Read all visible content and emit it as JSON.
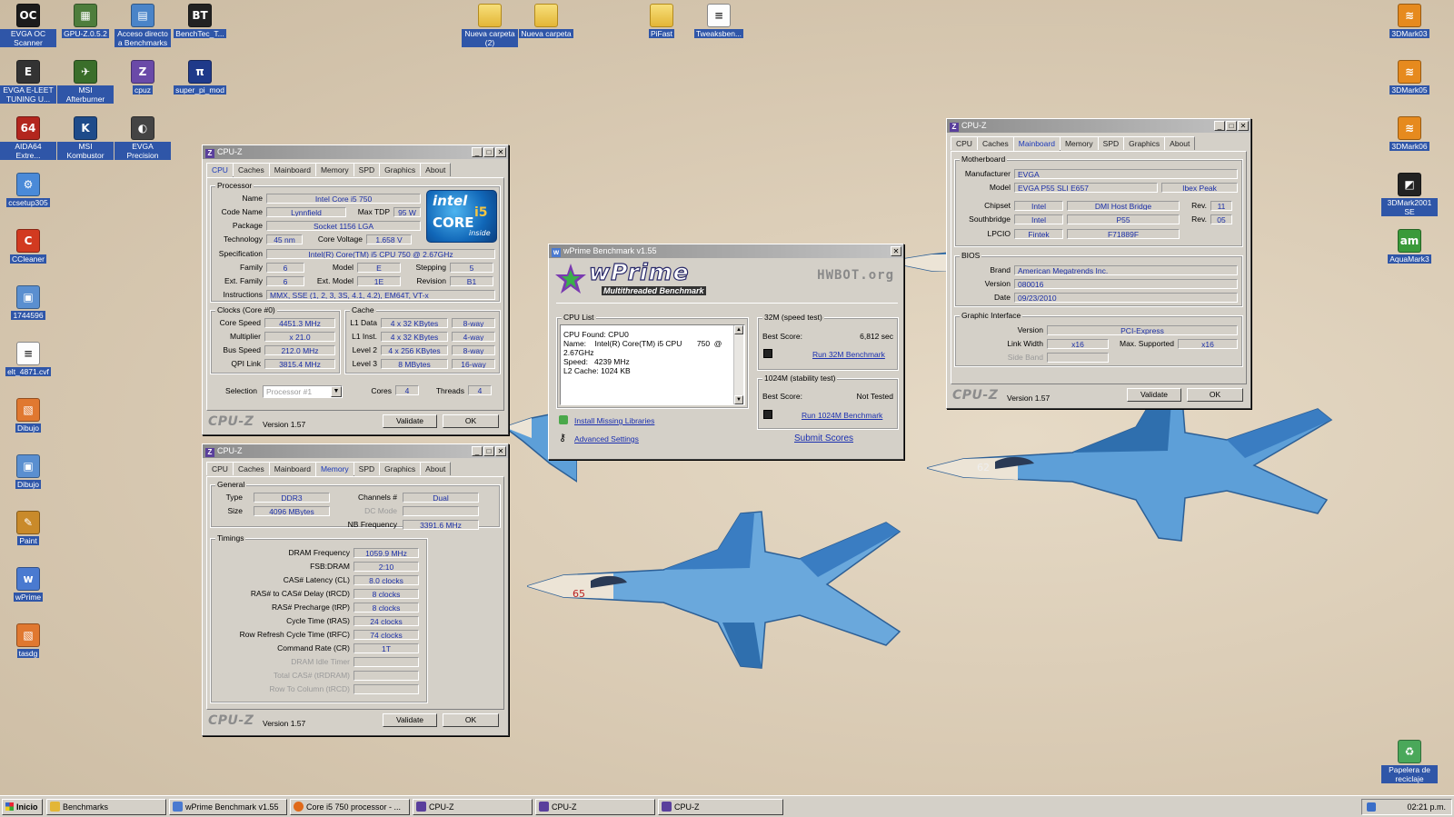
{
  "desktop_icons_left": [
    {
      "label": "EVGA OC Scanner",
      "icon": "evga-oc-icon",
      "color": "#1b1b1b",
      "glyph": "OC"
    },
    {
      "label": "GPU-Z.0.5.2",
      "icon": "gpuz-icon",
      "color": "#4e7d3c",
      "glyph": "▦"
    },
    {
      "label": "Acceso directo a Benchmarks",
      "icon": "folder-shortcut-icon",
      "color": "#4a84c8",
      "glyph": "▤"
    },
    {
      "label": "BenchTec_T...",
      "icon": "benchtec-icon",
      "color": "#222222",
      "glyph": "BT"
    },
    {
      "label": "EVGA E-LEET TUNING U...",
      "icon": "evga-eleet-icon",
      "color": "#333333",
      "glyph": "E"
    },
    {
      "label": "MSI Afterburner",
      "icon": "msi-afterburner-icon",
      "color": "#3a6e2a",
      "glyph": "✈"
    },
    {
      "label": "cpuz",
      "icon": "cpuz-icon",
      "color": "#6a4aa8",
      "glyph": "Z"
    },
    {
      "label": "super_pi_mod",
      "icon": "superpi-icon",
      "color": "#1f3a8a",
      "glyph": "π"
    },
    {
      "label": "AIDA64 Extre...",
      "icon": "aida64-icon",
      "color": "#b3261e",
      "glyph": "64"
    },
    {
      "label": "MSI Kombustor",
      "icon": "msi-kombustor-icon",
      "color": "#1e4b8a",
      "glyph": "K"
    },
    {
      "label": "EVGA Precision",
      "icon": "evga-precision-icon",
      "color": "#444444",
      "glyph": "◐"
    },
    {
      "label": "ccsetup305",
      "icon": "ccsetup-icon",
      "color": "#4a8ad8",
      "glyph": "⚙"
    },
    {
      "label": "CCleaner",
      "icon": "ccleaner-icon",
      "color": "#d23a20",
      "glyph": "C"
    },
    {
      "label": "1744596",
      "icon": "image-file-icon",
      "color": "#5a8fd0",
      "glyph": "▣"
    },
    {
      "label": "elt_4871.cvf",
      "icon": "document-icon",
      "color": "#ffffff",
      "glyph": "≡"
    },
    {
      "label": "Dibujo",
      "icon": "bitmap-icon",
      "color": "#e07830",
      "glyph": "▧"
    },
    {
      "label": "Dibujo",
      "icon": "image-file-icon-2",
      "color": "#5a8fd0",
      "glyph": "▣"
    },
    {
      "label": "Paint",
      "icon": "paint-icon",
      "color": "#c98a2a",
      "glyph": "✎"
    },
    {
      "label": "wPrime",
      "icon": "wprime-icon",
      "color": "#4a7ad0",
      "glyph": "w"
    },
    {
      "label": "tasdg",
      "icon": "bitmap-icon-2",
      "color": "#e07830",
      "glyph": "▧"
    }
  ],
  "desktop_icons_top": [
    {
      "label": "Nueva carpeta (2)",
      "icon": "folder-icon"
    },
    {
      "label": "Nueva carpeta",
      "icon": "folder-icon"
    },
    {
      "label": "PiFast",
      "icon": "folder-icon"
    },
    {
      "label": "Tweaksben...",
      "icon": "document-icon"
    }
  ],
  "desktop_icons_right": [
    {
      "label": "3DMark03",
      "icon": "3dmark03-icon",
      "color": "#e68a1e",
      "glyph": "≋"
    },
    {
      "label": "3DMark05",
      "icon": "3dmark05-icon",
      "color": "#e68a1e",
      "glyph": "≋"
    },
    {
      "label": "3DMark06",
      "icon": "3dmark06-icon",
      "color": "#e68a1e",
      "glyph": "≋"
    },
    {
      "label": "3DMark2001 SE",
      "icon": "3dmark2001-icon",
      "color": "#222222",
      "glyph": "◩"
    },
    {
      "label": "AquaMark3",
      "icon": "aquamark-icon",
      "color": "#3a9a3a",
      "glyph": "am"
    },
    {
      "label": "Papelera de reciclaje",
      "icon": "recycle-bin-icon",
      "color": "#4aa85a",
      "glyph": "♻"
    }
  ],
  "cpuz_cpu": {
    "title": "CPU-Z",
    "tabs": [
      "CPU",
      "Caches",
      "Mainboard",
      "Memory",
      "SPD",
      "Graphics",
      "About"
    ],
    "processor_group": "Processor",
    "labels": {
      "name": "Name",
      "code_name": "Code Name",
      "max_tdp": "Max TDP",
      "package": "Package",
      "technology": "Technology",
      "core_voltage": "Core Voltage",
      "specification": "Specification",
      "family": "Family",
      "model": "Model",
      "stepping": "Stepping",
      "ext_family": "Ext. Family",
      "ext_model": "Ext. Model",
      "revision": "Revision",
      "instructions": "Instructions"
    },
    "values": {
      "name": "Intel Core i5 750",
      "code_name": "Lynnfield",
      "max_tdp": "95 W",
      "package": "Socket 1156 LGA",
      "technology": "45 nm",
      "core_voltage": "1.658 V",
      "specification": "Intel(R) Core(TM) i5 CPU      750  @ 2.67GHz",
      "family": "6",
      "model": "E",
      "stepping": "5",
      "ext_family": "6",
      "ext_model": "1E",
      "revision": "B1",
      "instructions": "MMX, SSE (1, 2, 3, 3S, 4.1, 4.2), EM64T, VT-x"
    },
    "logo": {
      "brand": "intel",
      "line": "CORE",
      "model": "i5",
      "tag": "inside"
    },
    "clocks_group": "Clocks (Core #0)",
    "clocks_labels": {
      "core_speed": "Core Speed",
      "multiplier": "Multiplier",
      "bus_speed": "Bus Speed",
      "qpi_link": "QPI Link"
    },
    "clocks": {
      "core_speed": "4451.3 MHz",
      "multiplier": "x 21.0",
      "bus_speed": "212.0 MHz",
      "qpi_link": "3815.4 MHz"
    },
    "cache_group": "Cache",
    "cache_labels": {
      "l1_data": "L1 Data",
      "l1_inst": "L1 Inst.",
      "level2": "Level 2",
      "level3": "Level 3"
    },
    "cache": {
      "l1_data": "4 x 32 KBytes",
      "l1_data_way": "8-way",
      "l1_inst": "4 x 32 KBytes",
      "l1_inst_way": "4-way",
      "level2": "4 x 256 KBytes",
      "level2_way": "8-way",
      "level3": "8 MBytes",
      "level3_way": "16-way"
    },
    "selection_label": "Selection",
    "selection": "Processor #1",
    "cores_label": "Cores",
    "cores": "4",
    "threads_label": "Threads",
    "threads": "4",
    "brand": "CPU-Z",
    "version": "Version 1.57",
    "validate": "Validate",
    "ok": "OK"
  },
  "cpuz_memory": {
    "title": "CPU-Z",
    "tabs": [
      "CPU",
      "Caches",
      "Mainboard",
      "Memory",
      "SPD",
      "Graphics",
      "About"
    ],
    "general_group": "General",
    "labels": {
      "type": "Type",
      "size": "Size",
      "channels": "Channels #",
      "dc_mode": "DC Mode",
      "nb_frequency": "NB Frequency"
    },
    "values": {
      "type": "DDR3",
      "size": "4096 MBytes",
      "channels": "Dual",
      "dc_mode": "",
      "nb_frequency": "3391.6 MHz"
    },
    "timings_group": "Timings",
    "timings": [
      {
        "label": "DRAM Frequency",
        "value": "1059.9 MHz",
        "gray": false
      },
      {
        "label": "FSB:DRAM",
        "value": "2:10",
        "gray": false
      },
      {
        "label": "CAS# Latency (CL)",
        "value": "8.0 clocks",
        "gray": false
      },
      {
        "label": "RAS# to CAS# Delay (tRCD)",
        "value": "8 clocks",
        "gray": false
      },
      {
        "label": "RAS# Precharge (tRP)",
        "value": "8 clocks",
        "gray": false
      },
      {
        "label": "Cycle Time (tRAS)",
        "value": "24 clocks",
        "gray": false
      },
      {
        "label": "Row Refresh Cycle Time (tRFC)",
        "value": "74 clocks",
        "gray": false
      },
      {
        "label": "Command Rate (CR)",
        "value": "1T",
        "gray": false
      },
      {
        "label": "DRAM Idle Timer",
        "value": "",
        "gray": true
      },
      {
        "label": "Total CAS# (tRDRAM)",
        "value": "",
        "gray": true
      },
      {
        "label": "Row To Column (tRCD)",
        "value": "",
        "gray": true
      }
    ],
    "brand": "CPU-Z",
    "version": "Version 1.57",
    "validate": "Validate",
    "ok": "OK"
  },
  "cpuz_mainboard": {
    "title": "CPU-Z",
    "tabs": [
      "CPU",
      "Caches",
      "Mainboard",
      "Memory",
      "SPD",
      "Graphics",
      "About"
    ],
    "motherboard_group": "Motherboard",
    "labels": {
      "manufacturer": "Manufacturer",
      "model": "Model",
      "chipset": "Chipset",
      "southbridge": "Southbridge",
      "lpcio": "LPCIO",
      "rev": "Rev."
    },
    "values": {
      "manufacturer": "EVGA",
      "model": "EVGA P55 SLI E657",
      "model_rev": "Ibex Peak",
      "chipset_vendor": "Intel",
      "chipset_name": "DMI Host Bridge",
      "chipset_rev": "11",
      "southbridge_vendor": "Intel",
      "southbridge_name": "P55",
      "southbridge_rev": "05",
      "lpcio_vendor": "Fintek",
      "lpcio_name": "F71889F"
    },
    "bios_group": "BIOS",
    "bios_labels": {
      "brand": "Brand",
      "version": "Version",
      "date": "Date"
    },
    "bios": {
      "brand": "American Megatrends Inc.",
      "version": "080016",
      "date": "09/23/2010"
    },
    "graphic_group": "Graphic Interface",
    "graphic_labels": {
      "version": "Version",
      "link_width": "Link Width",
      "max_supported": "Max. Supported",
      "side_band": "Side Band"
    },
    "graphic": {
      "version": "PCI-Express",
      "link_width": "x16",
      "max_supported": "x16",
      "side_band": ""
    },
    "brand": "CPU-Z",
    "version": "Version 1.57",
    "validate": "Validate",
    "ok": "OK"
  },
  "wprime": {
    "title": "wPrime Benchmark v1.55",
    "logo": "wPrime",
    "tagline": "Multithreaded Benchmark",
    "hwbot": "HWBOT.org",
    "cpu_list_label": "CPU List",
    "cpu_list": "CPU Found: CPU0\nName:    Intel(R) Core(TM) i5 CPU       750  @\n2.67GHz\nSpeed:   4239 MHz\nL2 Cache: 1024 KB",
    "test32_label": "32M (speed test)",
    "best_score_label": "Best Score:",
    "score32": "6,812 sec",
    "run32": "Run 32M Benchmark",
    "test1024_label": "1024M (stability test)",
    "score1024": "Not Tested",
    "run1024": "Run 1024M Benchmark",
    "install_libs": "Install Missing Libraries",
    "advanced": "Advanced Settings",
    "submit": "Submit Scores"
  },
  "taskbar": {
    "start": "Inicio",
    "tasks": [
      {
        "label": "Benchmarks",
        "icon": "folder-icon",
        "color": "#e3b637"
      },
      {
        "label": "wPrime Benchmark v1.55",
        "icon": "wprime-icon",
        "color": "#4a7ad0"
      },
      {
        "label": "Core i5 750 processor - ...",
        "icon": "firefox-icon",
        "color": "#e06a1a"
      },
      {
        "label": "CPU-Z",
        "icon": "cpuz-icon",
        "color": "#5a3f9c"
      },
      {
        "label": "CPU-Z",
        "icon": "cpuz-icon",
        "color": "#5a3f9c"
      },
      {
        "label": "CPU-Z",
        "icon": "cpuz-icon",
        "color": "#5a3f9c"
      }
    ],
    "clock": "02:21 p.m."
  }
}
